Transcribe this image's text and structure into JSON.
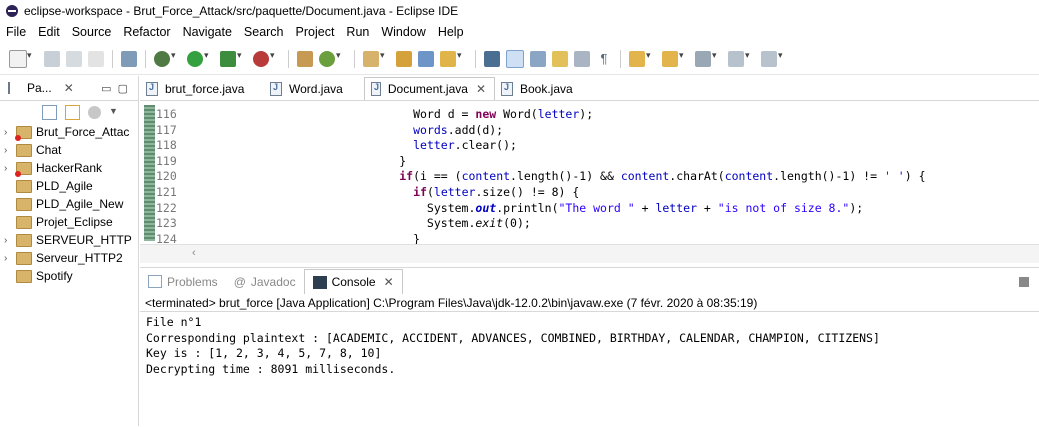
{
  "window": {
    "title": "eclipse-workspace - Brut_Force_Attack/src/paquette/Document.java - Eclipse IDE"
  },
  "menu": [
    "File",
    "Edit",
    "Source",
    "Refactor",
    "Navigate",
    "Search",
    "Project",
    "Run",
    "Window",
    "Help"
  ],
  "package_explorer": {
    "tab_label": "Pa...",
    "projects": [
      {
        "label": "Brut_Force_Attac",
        "expandable": true,
        "error": true
      },
      {
        "label": "Chat",
        "expandable": true,
        "error": false
      },
      {
        "label": "HackerRank",
        "expandable": true,
        "error": true
      },
      {
        "label": "PLD_Agile",
        "expandable": false,
        "error": false
      },
      {
        "label": "PLD_Agile_New",
        "expandable": false,
        "error": false
      },
      {
        "label": "Projet_Eclipse",
        "expandable": false,
        "error": false
      },
      {
        "label": "SERVEUR_HTTP",
        "expandable": true,
        "error": false
      },
      {
        "label": "Serveur_HTTP2",
        "expandable": true,
        "error": false
      },
      {
        "label": "Spotify",
        "expandable": false,
        "error": false
      }
    ]
  },
  "editor_tabs": [
    {
      "label": "brut_force.java",
      "active": false
    },
    {
      "label": "Word.java",
      "active": false
    },
    {
      "label": "Document.java",
      "active": true
    },
    {
      "label": "Book.java",
      "active": false
    }
  ],
  "code": {
    "line_numbers": [
      "116",
      "117",
      "118",
      "119",
      "120",
      "121",
      "122",
      "123",
      "124"
    ],
    "lines": [
      "Word d = new Word(letter);",
      "words.add(d);",
      "letter.clear();",
      "}",
      "if(i == (content.length()-1) && content.charAt(content.length()-1) != ' ') {",
      "if(letter.size() != 8) {",
      "System.out.println(\"The word \" + letter + \"is not of size 8.\");",
      "System.exit(0);",
      "}"
    ]
  },
  "console": {
    "tabs": [
      {
        "label": "Problems",
        "active": false
      },
      {
        "label": "Javadoc",
        "active": false
      },
      {
        "label": "Console",
        "active": true
      }
    ],
    "terminated": "<terminated> brut_force [Java Application] C:\\Program Files\\Java\\jdk-12.0.2\\bin\\javaw.exe (7 févr. 2020 à 08:35:19)",
    "output": [
      "File n°1",
      "Corresponding plaintext : [ACADEMIC, ACCIDENT, ADVANCES, COMBINED, BIRTHDAY, CALENDAR, CHAMPION, CITIZENS]",
      "Key is : [1, 2, 3, 4, 5, 7, 8, 10]",
      "Decrypting time : 8091 milliseconds."
    ]
  },
  "colors": {
    "keyword": "#7f0055",
    "field": "#0000c0",
    "string": "#2a00ff",
    "error": "#dd2222"
  }
}
